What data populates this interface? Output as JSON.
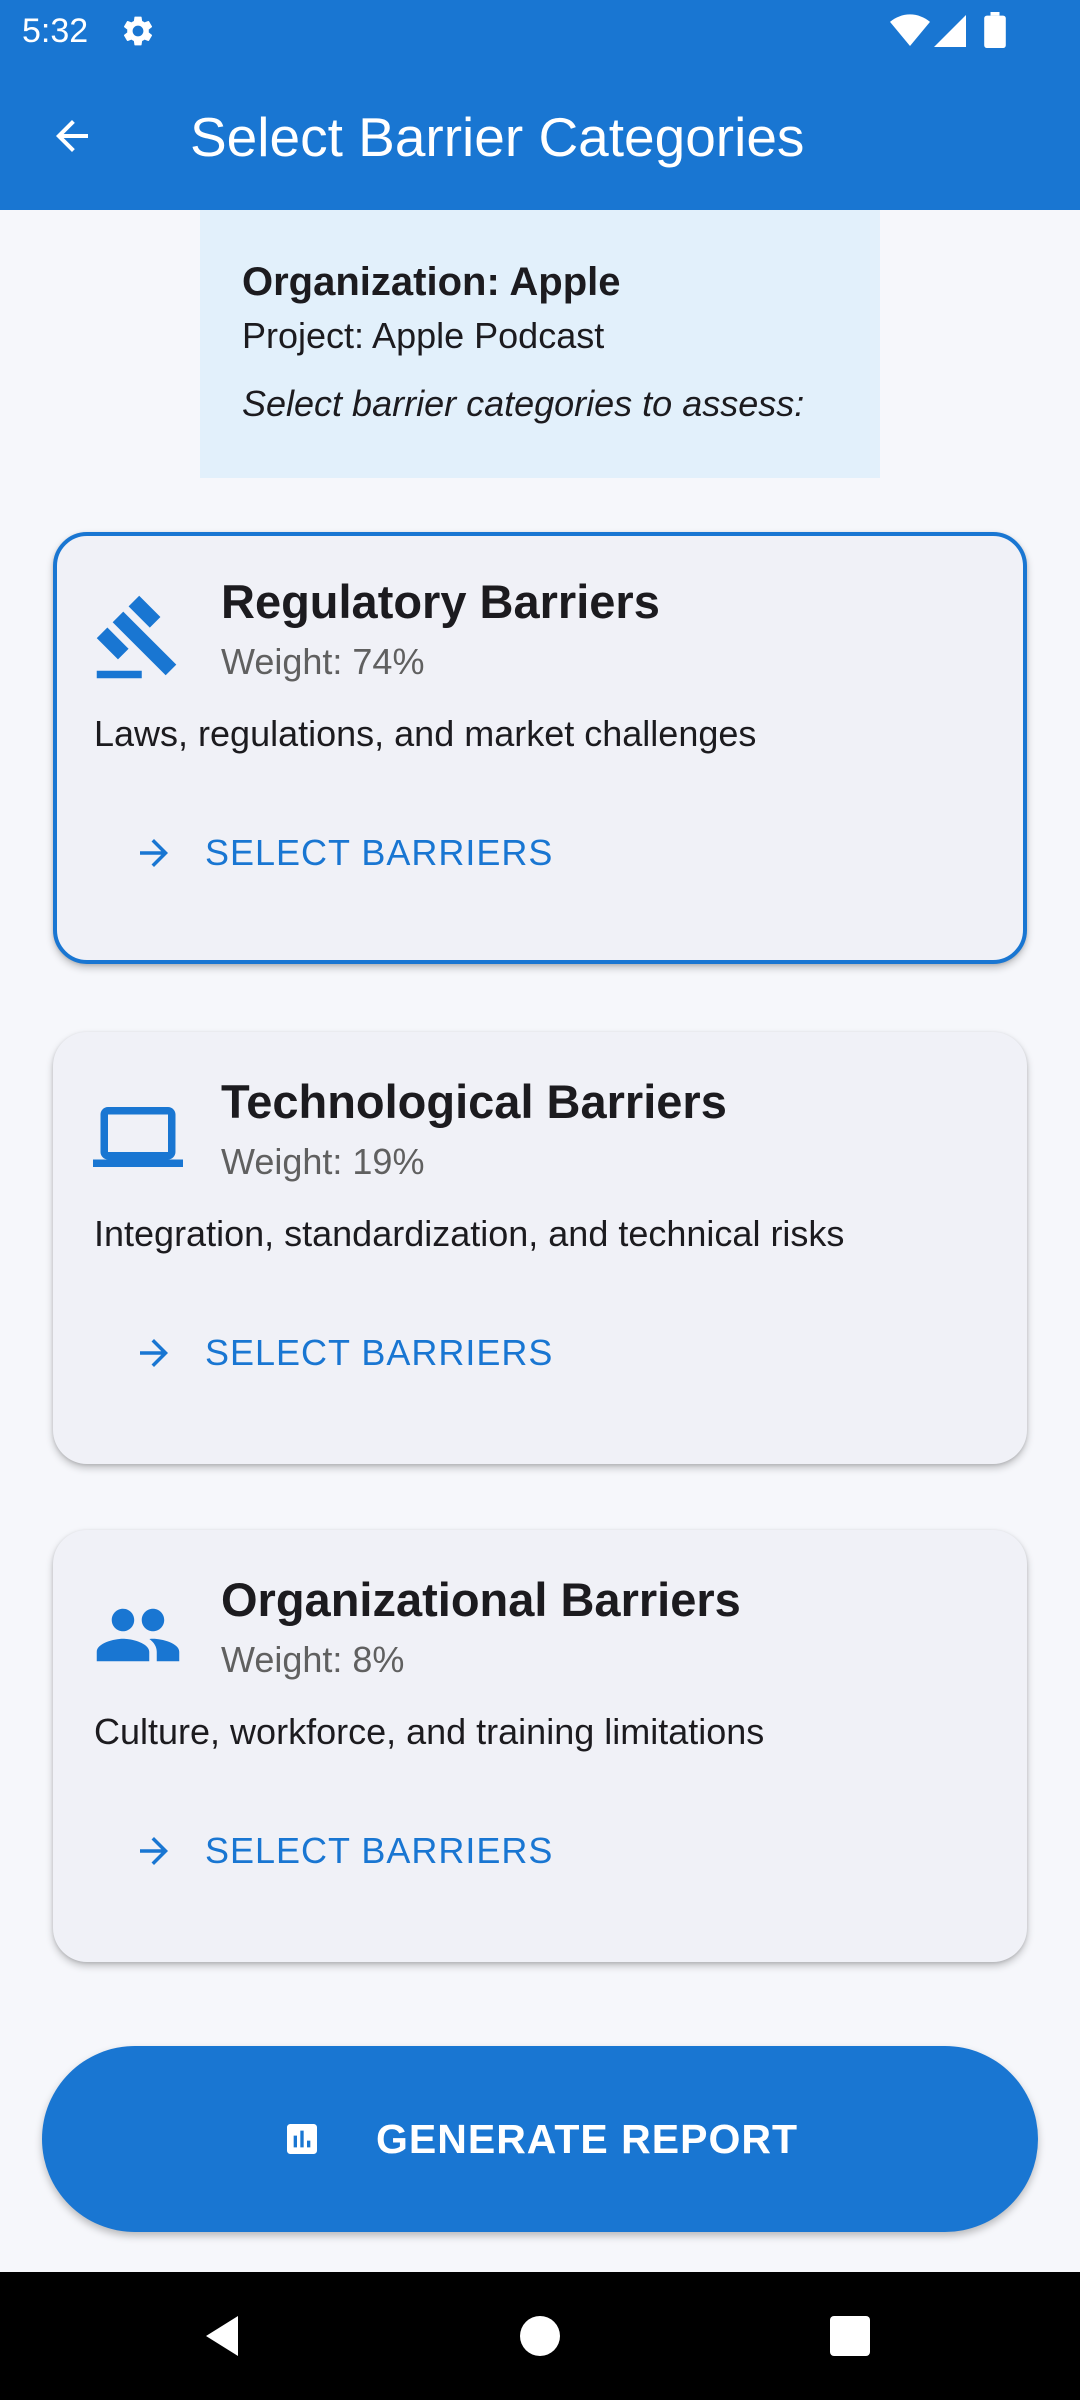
{
  "status_bar": {
    "time": "5:32",
    "icons": [
      "settings-icon",
      "wifi-icon",
      "cell-signal-icon",
      "battery-icon"
    ]
  },
  "app_bar": {
    "back_icon": "arrow-back-icon",
    "title": "Select Barrier Categories"
  },
  "info": {
    "organization": "Organization: Apple",
    "project": "Project: Apple Podcast",
    "instruction": "Select barrier categories to assess:"
  },
  "categories": [
    {
      "icon": "gavel-icon",
      "title": "Regulatory Barriers",
      "weight": "Weight: 74%",
      "description": "Laws, regulations, and market challenges",
      "action_label": "SELECT BARRIERS",
      "selected": true
    },
    {
      "icon": "laptop-icon",
      "title": "Technological Barriers",
      "weight": "Weight: 19%",
      "description": "Integration, standardization, and technical risks",
      "action_label": "SELECT BARRIERS",
      "selected": false
    },
    {
      "icon": "people-icon",
      "title": "Organizational Barriers",
      "weight": "Weight: 8%",
      "description": "Culture, workforce, and training limitations",
      "action_label": "SELECT BARRIERS",
      "selected": false
    }
  ],
  "generate_button": {
    "icon": "bar-chart-icon",
    "label": "GENERATE REPORT"
  },
  "nav_bar": {
    "icons": [
      "nav-back-icon",
      "nav-home-icon",
      "nav-recents-icon"
    ]
  },
  "colors": {
    "primary": "#1976d2",
    "info_background": "#e2f0fb",
    "card_background": "#f0f1f7",
    "page_background": "#f6f7fb"
  }
}
